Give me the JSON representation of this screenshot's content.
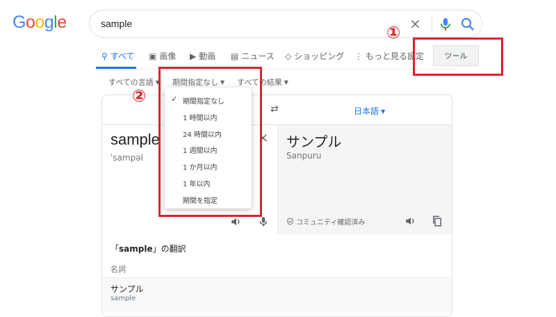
{
  "logo": {
    "letters": [
      "G",
      "o",
      "o",
      "g",
      "l",
      "e"
    ],
    "colors": [
      "#4285f4",
      "#ea4335",
      "#fbbc05",
      "#4285f4",
      "#34a853",
      "#ea4335"
    ]
  },
  "search": {
    "value": "sample",
    "clear": "×"
  },
  "tabs": [
    {
      "icon": "⚲",
      "label": "すべて",
      "active": true
    },
    {
      "icon": "▣",
      "label": "画像"
    },
    {
      "icon": "▶",
      "label": "動画"
    },
    {
      "icon": "▤",
      "label": "ニュース"
    },
    {
      "icon": "◇",
      "label": "ショッピング"
    },
    {
      "icon": "⋮",
      "label": "もっと見る"
    }
  ],
  "settings_label": "設定",
  "tools_label": "ツール",
  "filters": {
    "language": "すべての言語",
    "period": "期間指定なし",
    "results": "すべての結果"
  },
  "translate": {
    "swap": "⇄",
    "target_lang": "日本語",
    "src_word": "sample",
    "src_phonetic": "ˈsampəl",
    "src_clear": "×",
    "tgt_word": "サンプル",
    "tgt_roman": "Sanpuru",
    "verified": "コミュニティ確認済み",
    "heading_pre": "「",
    "heading_word": "sample",
    "heading_post": "」の翻訳",
    "pos": "名詞",
    "row_word": "サンプル",
    "row_sub": "sample"
  },
  "menu": {
    "check": "✓",
    "items": [
      "期間指定なし",
      "1 時間以内",
      "24 時間以内",
      "1 週間以内",
      "1 か月以内",
      "1 年以内",
      "期間を指定"
    ]
  },
  "annotations": {
    "one": "①",
    "two": "②",
    "color": "#d6242d"
  },
  "colors": {
    "accent": "#1a73e8"
  }
}
